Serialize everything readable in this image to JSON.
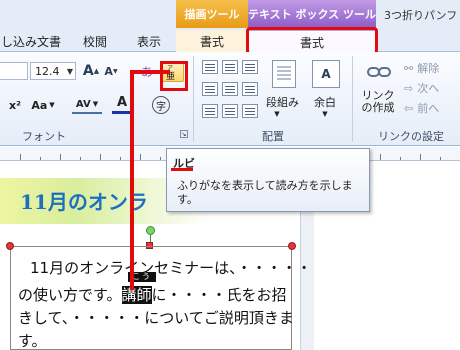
{
  "window_title": "3つ折りパンフ",
  "contextual_headers": {
    "drawing": "描画ツール",
    "textbox": "テキスト ボックス ツール"
  },
  "tabs": {
    "mail_merge": "し込み文書",
    "review": "校閲",
    "view": "表示",
    "format_drawing": "書式",
    "format_textbox": "書式"
  },
  "ribbon": {
    "font_size": "12.4",
    "font_group_label": "フォント",
    "arrange_group_label": "配置",
    "link_group_label": "リンクの設定",
    "columns_label": "段組み",
    "margins_label": "余白",
    "create_link_label": "リンクの作成",
    "break_link_label": "解除",
    "next_label": "次へ",
    "prev_label": "前へ",
    "ruby_glyph": "ア亜",
    "grow_font": "A",
    "shrink_font": "A",
    "clear_format": "あ",
    "superscript": "x²",
    "change_case": "Aa",
    "char_spacing": "AV",
    "font_color": "A",
    "enclose_char": "字"
  },
  "tooltip": {
    "title": "ルビ",
    "description": "ふりがなを表示して読み方を示します。"
  },
  "document": {
    "heading": "11月のオンラ",
    "line1": "11月のオンラインセミナーは、・・・・・",
    "line2_before": "の使い方です。",
    "line2_selected": "講師",
    "line2_after": "に・・・・氏をお招",
    "line3": "きして、・・・・・についてご説明頂きま",
    "line4": "す。",
    "ruby": "こうし"
  },
  "colors": {
    "accent_red": "#e20b0b",
    "drawing_tools": "#f2ae2e",
    "textbox_tools": "#a578d8",
    "heading_blue": "#1d6fbf"
  }
}
